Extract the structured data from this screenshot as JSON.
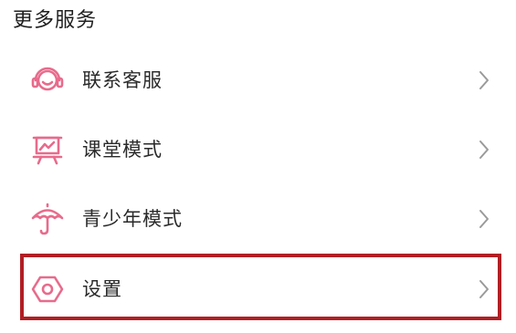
{
  "section": {
    "title": "更多服务"
  },
  "items": [
    {
      "label": "联系客服",
      "icon": "headset-icon"
    },
    {
      "label": "课堂模式",
      "icon": "presentation-board-icon"
    },
    {
      "label": "青少年模式",
      "icon": "umbrella-icon"
    },
    {
      "label": "设置",
      "icon": "hexagon-gear-icon"
    }
  ],
  "colors": {
    "icon_accent": "#e86b8c",
    "text": "#2a2a2a",
    "chevron": "#9a9a9a",
    "highlight_border": "#b11e24"
  }
}
